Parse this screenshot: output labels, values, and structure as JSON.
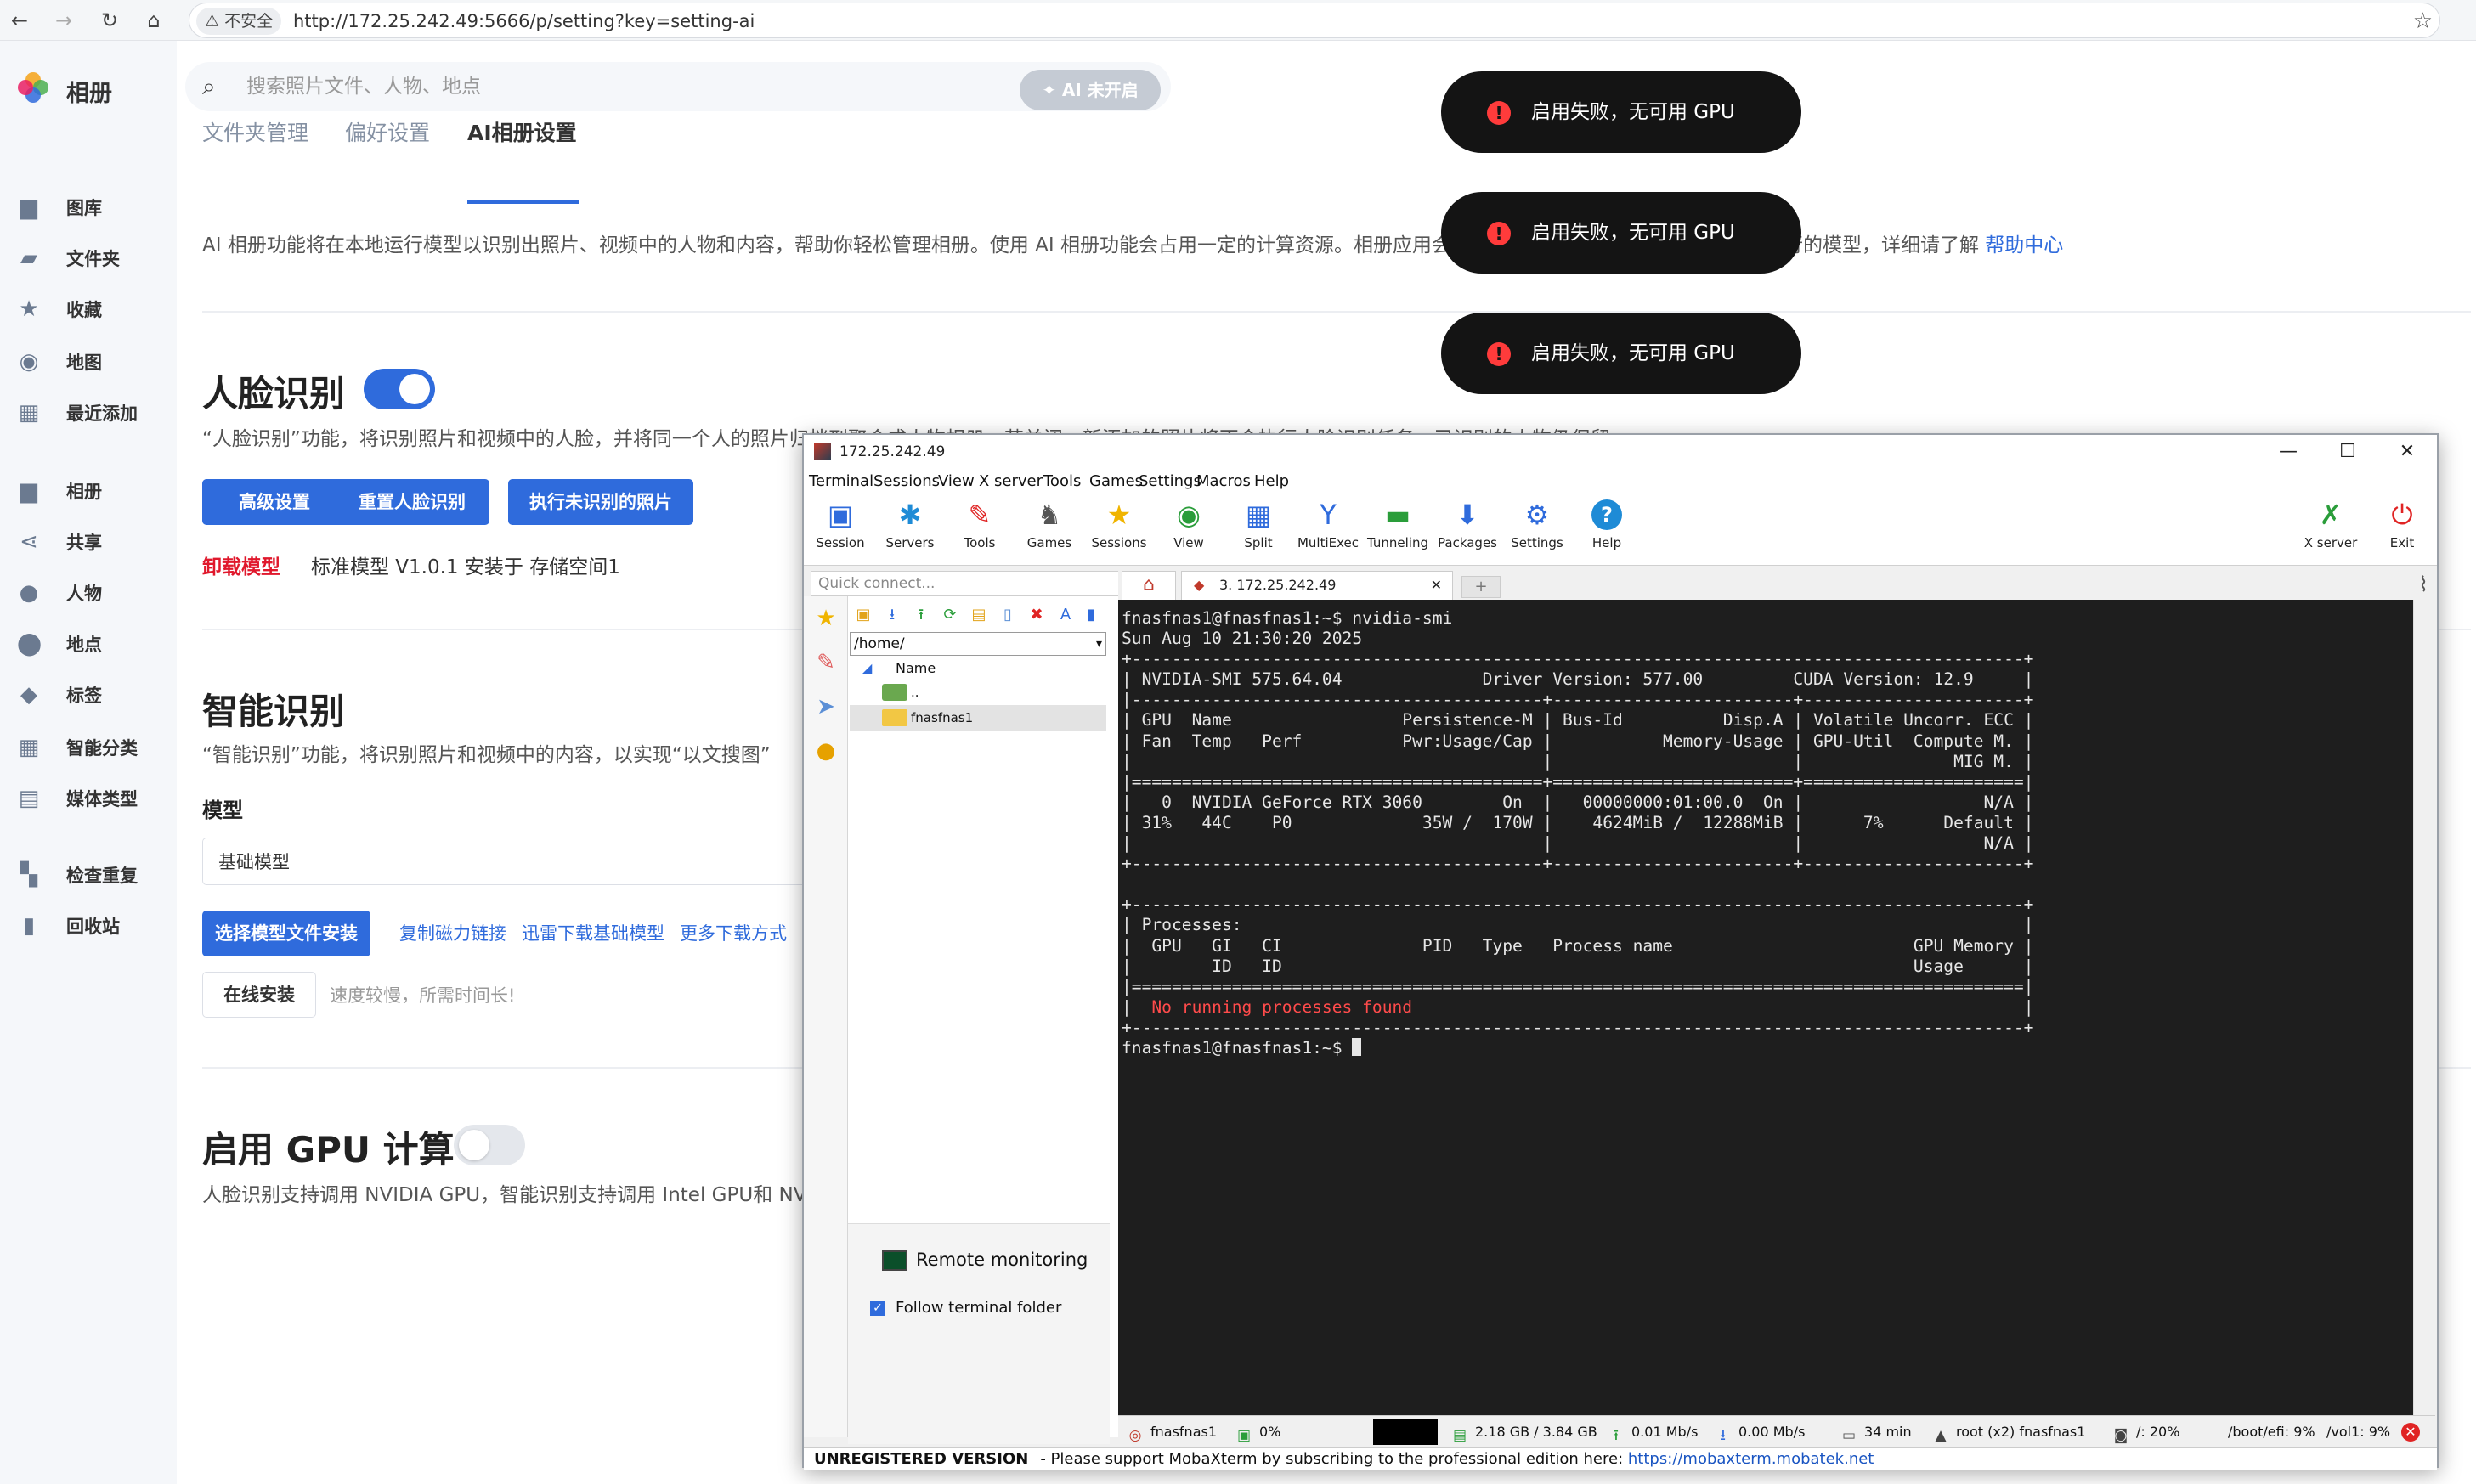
{
  "browser": {
    "unsafe_label": "⚠ 不安全",
    "url": "http://172.25.242.49:5666/p/setting?key=setting-ai"
  },
  "app": {
    "title": "相册",
    "search_placeholder": "搜索照片文件、人物、地点",
    "ai_badge": "✦ AI 未开启"
  },
  "sidebar": {
    "items": [
      {
        "label": "图库",
        "icon": "image-icon"
      },
      {
        "label": "文件夹",
        "icon": "folder-icon"
      },
      {
        "label": "收藏",
        "icon": "star-icon"
      },
      {
        "label": "地图",
        "icon": "map-icon"
      },
      {
        "label": "最近添加",
        "icon": "calendar-icon"
      },
      {
        "label": "相册",
        "icon": "album-icon"
      },
      {
        "label": "共享",
        "icon": "share-icon"
      },
      {
        "label": "人物",
        "icon": "person-icon"
      },
      {
        "label": "地点",
        "icon": "pin-icon"
      },
      {
        "label": "标签",
        "icon": "tag-icon"
      },
      {
        "label": "智能分类",
        "icon": "grid-icon"
      },
      {
        "label": "媒体类型",
        "icon": "media-icon"
      },
      {
        "label": "检查重复",
        "icon": "duplicate-icon"
      },
      {
        "label": "回收站",
        "icon": "trash-icon"
      }
    ]
  },
  "tabs": [
    "文件夹管理",
    "偏好设置",
    "AI相册设置"
  ],
  "description": {
    "text": "AI 相册功能将在本地运行模型以识别出照片、视频中的人物和内容，帮助你轻松管理相册。使用 AI 相册功能会占用一定的计算资源。相册应用会自动根据设备的硬件条件并选择适合运行的模型，详细请了解 ",
    "help_link": "帮助中心"
  },
  "face": {
    "title": "人脸识别",
    "desc": "“人脸识别”功能，将识别照片和视频中的人脸，并将同一个人的照片归档到聚合成人物相册。若关闭，新添加的照片将不会执行人脸识别任务，已识别的人物仍保留。",
    "btn_advanced": "高级设置",
    "btn_reset": "重置人脸识别",
    "btn_run": "执行未识别的照片",
    "uninstall": "卸载模型",
    "model_info": "标准模型 V1.0.1 安装于 存储空间1"
  },
  "smart": {
    "title": "智能识别",
    "desc": "“智能识别”功能，将识别照片和视频中的内容，以实现“以文搜图”",
    "model_label": "模型",
    "model_value": "基础模型",
    "btn_install": "选择模型文件安装",
    "link_magnet": "复制磁力链接",
    "link_thunder": "迅雷下载基础模型",
    "link_more": "更多下载方式",
    "btn_online": "在线安装",
    "online_tip": "速度较慢，所需时间长!"
  },
  "gpu": {
    "title": "启用 GPU 计算",
    "desc": "人脸识别支持调用 NVIDIA GPU，智能识别支持调用 Intel GPU和 NVIDIA GPU"
  },
  "toasts": [
    "启用失败，无可用 GPU",
    "启用失败，无可用 GPU",
    "启用失败，无可用 GPU"
  ],
  "moba": {
    "title": "172.25.242.49",
    "menu": [
      "Terminal",
      "Sessions",
      "View",
      "X server",
      "Tools",
      "Games",
      "Settings",
      "Macros",
      "Help"
    ],
    "toolbar": [
      "Session",
      "Servers",
      "Tools",
      "Games",
      "Sessions",
      "View",
      "Split",
      "MultiExec",
      "Tunneling",
      "Packages",
      "Settings",
      "Help"
    ],
    "xserver": "X server",
    "exit": "Exit",
    "quick_connect": "Quick connect...",
    "path": "/home/",
    "col_name": "Name",
    "files": [
      "..",
      "fnasfnas1"
    ],
    "remote_monitoring": "Remote monitoring",
    "follow_folder": "Follow terminal folder",
    "tab_label": "3. 172.25.242.49",
    "unregistered": "UNREGISTERED VERSION",
    "support_text": "-  Please support MobaXterm by subscribing to the professional edition here:",
    "support_link": "https://mobaxterm.mobatek.net",
    "status": {
      "host": "fnasfnas1",
      "cpu": "0%",
      "mem": "2.18 GB / 3.84 GB",
      "up": "0.01 Mb/s",
      "down": "0.00 Mb/s",
      "uptime": "34 min",
      "users": "root (x2)  fnasfnas1",
      "disk1": "/: 20%",
      "disk2": "/boot/efi: 9%",
      "disk3": "/vol1: 9%"
    }
  },
  "terminal": {
    "prompt_cmd": "fnasfnas1@fnasfnas1:~$ nvidia-smi",
    "date": "Sun Aug 10 21:30:20 2025",
    "lines": [
      "+-----------------------------------------------------------------------------------------+",
      "| NVIDIA-SMI 575.64.04              Driver Version: 577.00         CUDA Version: 12.9     |",
      "|-----------------------------------------+------------------------+----------------------+",
      "| GPU  Name                 Persistence-M | Bus-Id          Disp.A | Volatile Uncorr. ECC |",
      "| Fan  Temp   Perf          Pwr:Usage/Cap |           Memory-Usage | GPU-Util  Compute M. |",
      "|                                         |                        |               MIG M. |",
      "|=========================================+========================+======================|",
      "|   0  NVIDIA GeForce RTX 3060        On  |   00000000:01:00.0  On |                  N/A |",
      "| 31%   44C    P0             35W /  170W |    4624MiB /  12288MiB |      7%      Default |",
      "|                                         |                        |                  N/A |",
      "+-----------------------------------------+------------------------+----------------------+",
      "",
      "+-----------------------------------------------------------------------------------------+",
      "| Processes:                                                                              |",
      "|  GPU   GI   CI              PID   Type   Process name                        GPU Memory |",
      "|        ID   ID                                                               Usage      |",
      "|=========================================================================================|"
    ],
    "no_proc_prefix": "|  ",
    "no_proc": "No running processes found",
    "no_proc_suffix": "                                                             |",
    "last_border": "+-----------------------------------------------------------------------------------------+",
    "prompt": "fnasfnas1@fnasfnas1:~$ "
  },
  "colors": {
    "accent": "#2f6bdc",
    "danger": "#e0182c",
    "toast_bg": "#141414"
  }
}
